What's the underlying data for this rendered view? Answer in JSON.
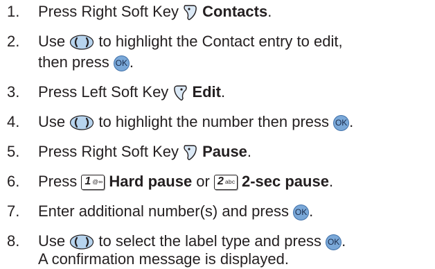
{
  "steps": [
    {
      "num": "1.",
      "parts": {
        "text1": "Press Right Soft Key ",
        "bold1": "Contacts",
        "end": "."
      }
    },
    {
      "num": "2.",
      "parts": {
        "text1": "Use ",
        "text2": " to highlight the Contact entry to edit,",
        "line2": "then press ",
        "ok": "OK",
        "end": "."
      }
    },
    {
      "num": "3.",
      "parts": {
        "text1": "Press Left Soft Key ",
        "bold1": "Edit",
        "end": "."
      }
    },
    {
      "num": "4.",
      "parts": {
        "text1": "Use ",
        "text2": " to highlight the number then press ",
        "ok": "OK",
        "end": "."
      }
    },
    {
      "num": "5.",
      "parts": {
        "text1": "Press Right Soft Key ",
        "bold1": "Pause",
        "end": "."
      }
    },
    {
      "num": "6.",
      "parts": {
        "text1": "Press ",
        "key1_num": "1",
        "key1_sym": "@∞",
        "bold1": "Hard pause",
        "mid": " or ",
        "key2_num": "2",
        "key2_sym": "abc",
        "bold2": "2-sec pause",
        "end": "."
      }
    },
    {
      "num": "7.",
      "parts": {
        "text1": "Enter additional number(s) and press ",
        "ok": "OK",
        "end": "."
      }
    },
    {
      "num": "8.",
      "parts": {
        "text1": "Use ",
        "text2": " to select the label type and press ",
        "ok": "OK",
        "end": ".",
        "line2": "A confirmation message is displayed."
      }
    }
  ],
  "icons": {
    "right_soft_key": "right-soft-key-icon",
    "left_soft_key": "left-soft-key-icon",
    "nav_key": "navigation-key-icon",
    "ok_key": "ok-button-icon"
  },
  "colors": {
    "text": "#231f20",
    "ok_fill": "#7aa8d8",
    "nav_fill": "#b7d4ee",
    "soft_key_fill": "#dbe9f6"
  }
}
